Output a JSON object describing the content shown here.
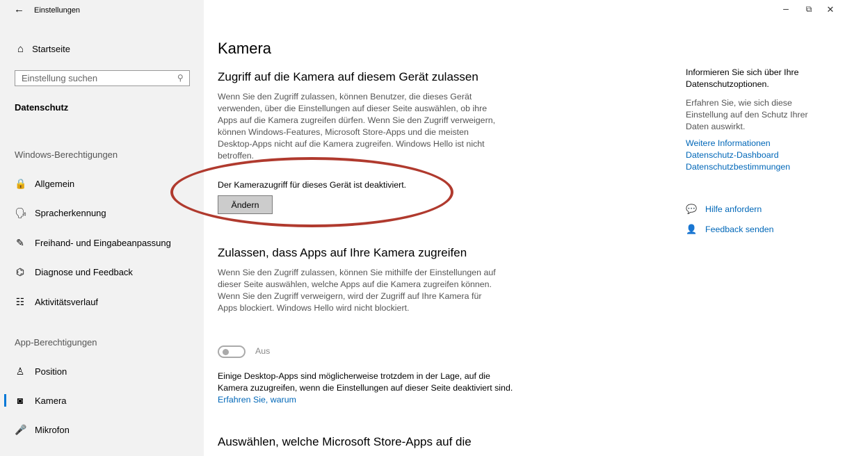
{
  "window": {
    "back_icon": "←",
    "title": "Einstellungen",
    "controls": {
      "minimize": "–",
      "restore": "⧉",
      "close": "✕"
    }
  },
  "sidebar": {
    "home": {
      "icon": "⌂",
      "label": "Startseite"
    },
    "search": {
      "placeholder": "Einstellung suchen",
      "icon": "⚲"
    },
    "section_title": "Datenschutz",
    "windows_group": "Windows-Berechtigungen",
    "windows_items": [
      {
        "icon": "🔒",
        "label": "Allgemein"
      },
      {
        "icon": "🗣",
        "label": "Spracherkennung"
      },
      {
        "icon": "✎",
        "label": "Freihand- und Eingabeanpassung"
      },
      {
        "icon": "⌬",
        "label": "Diagnose und Feedback"
      },
      {
        "icon": "☷",
        "label": "Aktivitätsverlauf"
      }
    ],
    "app_group": "App-Berechtigungen",
    "app_items": [
      {
        "icon": "♙",
        "label": "Position"
      },
      {
        "icon": "◙",
        "label": "Kamera"
      },
      {
        "icon": "🎤",
        "label": "Mikrofon"
      }
    ],
    "active_item": "Kamera",
    "accent_color": "#0078d7"
  },
  "main": {
    "page_title": "Kamera",
    "section1": {
      "heading": "Zugriff auf die Kamera auf diesem Gerät zulassen",
      "description": "Wenn Sie den Zugriff zulassen, können Benutzer, die dieses Gerät verwenden, über die Einstellungen auf dieser Seite auswählen, ob ihre Apps auf die Kamera zugreifen dürfen. Wenn Sie den Zugriff verweigern, können Windows-Features, Microsoft Store-Apps und die meisten Desktop-Apps nicht auf die Kamera zugreifen. Windows Hello ist nicht betroffen.",
      "status": "Der Kamerazugriff für dieses Gerät ist deaktiviert.",
      "change_button": "Ändern",
      "highlight_color": "#b03a2e"
    },
    "section2": {
      "heading": "Zulassen, dass Apps auf Ihre Kamera zugreifen",
      "description": "Wenn Sie den Zugriff zulassen, können Sie mithilfe der Einstellungen auf dieser Seite auswählen, welche Apps auf die Kamera zugreifen können. Wenn Sie den Zugriff verweigern, wird der Zugriff auf Ihre Kamera für Apps blockiert. Windows Hello wird nicht blockiert.",
      "toggle_state": "Aus",
      "note": "Einige Desktop-Apps sind möglicherweise trotzdem in der Lage, auf die Kamera zuzugreifen, wenn die Einstellungen auf dieser Seite deaktiviert sind.",
      "note_link": "Erfahren Sie, warum"
    },
    "section3": {
      "heading": "Auswählen, welche Microsoft Store-Apps auf die"
    }
  },
  "right_panel": {
    "title": "Informieren Sie sich über Ihre Datenschutzoptionen.",
    "text": "Erfahren Sie, wie sich diese Einstellung auf den Schutz Ihrer Daten auswirkt.",
    "links": [
      "Weitere Informationen",
      "Datenschutz-Dashboard",
      "Datenschutzbestimmungen"
    ],
    "help": {
      "icon": "💬",
      "label": "Hilfe anfordern"
    },
    "feedback": {
      "icon": "👤",
      "label": "Feedback senden"
    },
    "link_color": "#0067b8"
  }
}
